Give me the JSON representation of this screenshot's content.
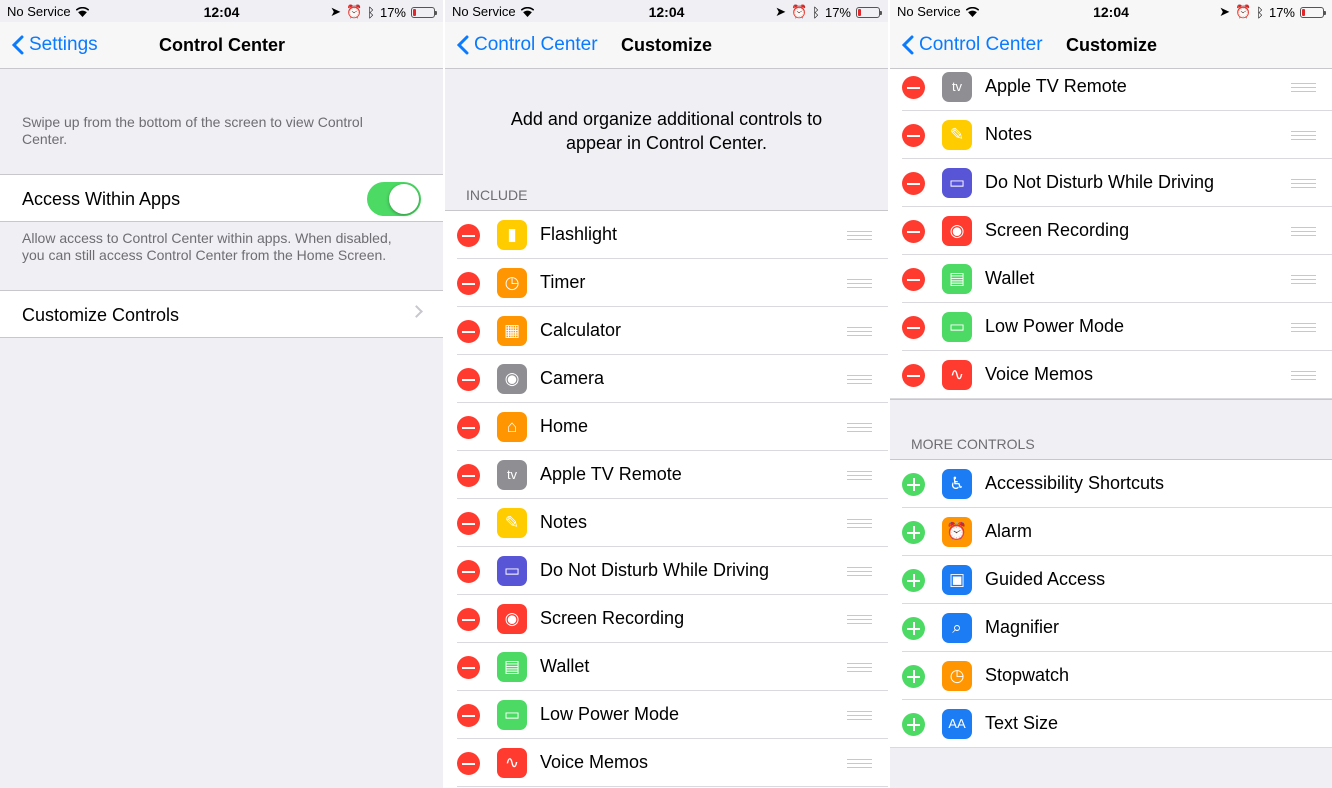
{
  "status": {
    "carrier": "No Service",
    "time": "12:04",
    "battery": "17%",
    "battery_level": 0.17
  },
  "screen1": {
    "back_label": "Settings",
    "title": "Control Center",
    "intro": "Swipe up from the bottom of the screen to view Control Center.",
    "access_label": "Access Within Apps",
    "access_on": true,
    "access_footer": "Allow access to Control Center within apps. When disabled, you can still access Control Center from the Home Screen.",
    "customize_label": "Customize Controls"
  },
  "screen2": {
    "back_label": "Control Center",
    "title": "Customize",
    "intro": "Add and organize additional controls to appear in Control Center.",
    "include_header": "INCLUDE",
    "include": [
      {
        "label": "Flashlight",
        "icon": "flashlight-icon",
        "color": "#ffcc00"
      },
      {
        "label": "Timer",
        "icon": "timer-icon",
        "color": "#ff9500"
      },
      {
        "label": "Calculator",
        "icon": "calculator-icon",
        "color": "#ff9500"
      },
      {
        "label": "Camera",
        "icon": "camera-icon",
        "color": "#8e8e93"
      },
      {
        "label": "Home",
        "icon": "home-icon",
        "color": "#ff9500"
      },
      {
        "label": "Apple TV Remote",
        "icon": "apple-tv-icon",
        "color": "#8e8e93"
      },
      {
        "label": "Notes",
        "icon": "notes-icon",
        "color": "#ffcc00"
      },
      {
        "label": "Do Not Disturb While Driving",
        "icon": "car-icon",
        "color": "#5856d6"
      },
      {
        "label": "Screen Recording",
        "icon": "record-icon",
        "color": "#ff3b30"
      },
      {
        "label": "Wallet",
        "icon": "wallet-icon",
        "color": "#4cd964"
      },
      {
        "label": "Low Power Mode",
        "icon": "battery-icon",
        "color": "#4cd964"
      },
      {
        "label": "Voice Memos",
        "icon": "waveform-icon",
        "color": "#ff3b30"
      }
    ]
  },
  "screen3": {
    "back_label": "Control Center",
    "title": "Customize",
    "include_visible": [
      {
        "label": "Apple TV Remote",
        "icon": "apple-tv-icon",
        "color": "#8e8e93"
      },
      {
        "label": "Notes",
        "icon": "notes-icon",
        "color": "#ffcc00"
      },
      {
        "label": "Do Not Disturb While Driving",
        "icon": "car-icon",
        "color": "#5856d6"
      },
      {
        "label": "Screen Recording",
        "icon": "record-icon",
        "color": "#ff3b30"
      },
      {
        "label": "Wallet",
        "icon": "wallet-icon",
        "color": "#4cd964"
      },
      {
        "label": "Low Power Mode",
        "icon": "battery-icon",
        "color": "#4cd964"
      },
      {
        "label": "Voice Memos",
        "icon": "waveform-icon",
        "color": "#ff3b30"
      }
    ],
    "more_header": "MORE CONTROLS",
    "more": [
      {
        "label": "Accessibility Shortcuts",
        "icon": "accessibility-icon",
        "color": "#1c7cf4"
      },
      {
        "label": "Alarm",
        "icon": "alarm-icon",
        "color": "#ff9500"
      },
      {
        "label": "Guided Access",
        "icon": "guided-access-icon",
        "color": "#1c7cf4"
      },
      {
        "label": "Magnifier",
        "icon": "magnifier-icon",
        "color": "#1c7cf4"
      },
      {
        "label": "Stopwatch",
        "icon": "stopwatch-icon",
        "color": "#ff9500"
      },
      {
        "label": "Text Size",
        "icon": "text-size-icon",
        "color": "#1c7cf4"
      }
    ]
  },
  "colors": {
    "accent": "#0a7aff",
    "toggle_on": "#4cd964",
    "delete": "#ff3b30"
  }
}
